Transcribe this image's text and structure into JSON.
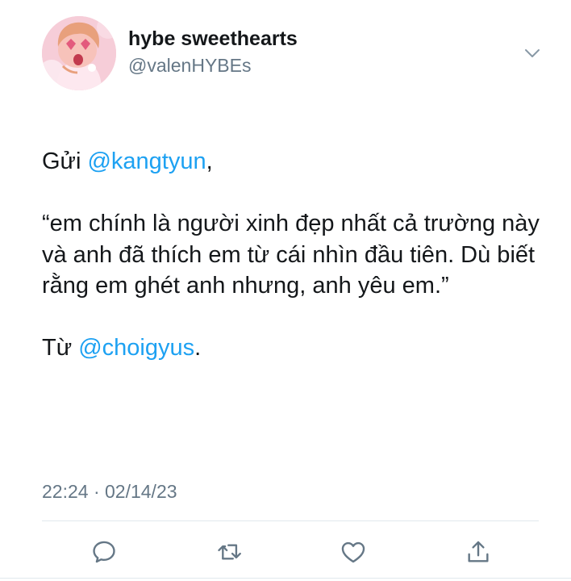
{
  "tweet": {
    "author": {
      "display_name": "hybe sweethearts",
      "handle": "@valenHYBEs",
      "avatar_icon": "anime-avatar"
    },
    "body": {
      "line1_prefix": "Gửi ",
      "line1_mention": "@kangtyun",
      "line1_suffix": ",",
      "quote": "“em chính là người xinh đẹp nhất cả trường này và anh đã thích em từ cái nhìn đầu tiên. Dù biết rằng em ghét anh nhưng, anh yêu em.”",
      "from_prefix": "Từ ",
      "from_mention": "@choigyus",
      "from_suffix": "."
    },
    "timestamp": "22:24 · 02/14/23",
    "actions": [
      "reply-icon",
      "retweet-icon",
      "like-icon",
      "share-icon"
    ]
  },
  "colors": {
    "text": "#14171a",
    "secondary": "#657786",
    "link": "#1da1f2",
    "divider": "#e1e8ed"
  }
}
